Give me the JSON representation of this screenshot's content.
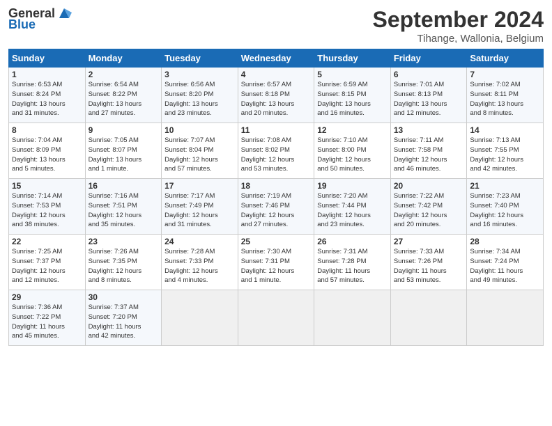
{
  "header": {
    "logo_text_general": "General",
    "logo_text_blue": "Blue",
    "month_title": "September 2024",
    "location": "Tihange, Wallonia, Belgium"
  },
  "weekdays": [
    "Sunday",
    "Monday",
    "Tuesday",
    "Wednesday",
    "Thursday",
    "Friday",
    "Saturday"
  ],
  "weeks": [
    [
      {
        "day": "1",
        "info": "Sunrise: 6:53 AM\nSunset: 8:24 PM\nDaylight: 13 hours\nand 31 minutes."
      },
      {
        "day": "2",
        "info": "Sunrise: 6:54 AM\nSunset: 8:22 PM\nDaylight: 13 hours\nand 27 minutes."
      },
      {
        "day": "3",
        "info": "Sunrise: 6:56 AM\nSunset: 8:20 PM\nDaylight: 13 hours\nand 23 minutes."
      },
      {
        "day": "4",
        "info": "Sunrise: 6:57 AM\nSunset: 8:18 PM\nDaylight: 13 hours\nand 20 minutes."
      },
      {
        "day": "5",
        "info": "Sunrise: 6:59 AM\nSunset: 8:15 PM\nDaylight: 13 hours\nand 16 minutes."
      },
      {
        "day": "6",
        "info": "Sunrise: 7:01 AM\nSunset: 8:13 PM\nDaylight: 13 hours\nand 12 minutes."
      },
      {
        "day": "7",
        "info": "Sunrise: 7:02 AM\nSunset: 8:11 PM\nDaylight: 13 hours\nand 8 minutes."
      }
    ],
    [
      {
        "day": "8",
        "info": "Sunrise: 7:04 AM\nSunset: 8:09 PM\nDaylight: 13 hours\nand 5 minutes."
      },
      {
        "day": "9",
        "info": "Sunrise: 7:05 AM\nSunset: 8:07 PM\nDaylight: 13 hours\nand 1 minute."
      },
      {
        "day": "10",
        "info": "Sunrise: 7:07 AM\nSunset: 8:04 PM\nDaylight: 12 hours\nand 57 minutes."
      },
      {
        "day": "11",
        "info": "Sunrise: 7:08 AM\nSunset: 8:02 PM\nDaylight: 12 hours\nand 53 minutes."
      },
      {
        "day": "12",
        "info": "Sunrise: 7:10 AM\nSunset: 8:00 PM\nDaylight: 12 hours\nand 50 minutes."
      },
      {
        "day": "13",
        "info": "Sunrise: 7:11 AM\nSunset: 7:58 PM\nDaylight: 12 hours\nand 46 minutes."
      },
      {
        "day": "14",
        "info": "Sunrise: 7:13 AM\nSunset: 7:55 PM\nDaylight: 12 hours\nand 42 minutes."
      }
    ],
    [
      {
        "day": "15",
        "info": "Sunrise: 7:14 AM\nSunset: 7:53 PM\nDaylight: 12 hours\nand 38 minutes."
      },
      {
        "day": "16",
        "info": "Sunrise: 7:16 AM\nSunset: 7:51 PM\nDaylight: 12 hours\nand 35 minutes."
      },
      {
        "day": "17",
        "info": "Sunrise: 7:17 AM\nSunset: 7:49 PM\nDaylight: 12 hours\nand 31 minutes."
      },
      {
        "day": "18",
        "info": "Sunrise: 7:19 AM\nSunset: 7:46 PM\nDaylight: 12 hours\nand 27 minutes."
      },
      {
        "day": "19",
        "info": "Sunrise: 7:20 AM\nSunset: 7:44 PM\nDaylight: 12 hours\nand 23 minutes."
      },
      {
        "day": "20",
        "info": "Sunrise: 7:22 AM\nSunset: 7:42 PM\nDaylight: 12 hours\nand 20 minutes."
      },
      {
        "day": "21",
        "info": "Sunrise: 7:23 AM\nSunset: 7:40 PM\nDaylight: 12 hours\nand 16 minutes."
      }
    ],
    [
      {
        "day": "22",
        "info": "Sunrise: 7:25 AM\nSunset: 7:37 PM\nDaylight: 12 hours\nand 12 minutes."
      },
      {
        "day": "23",
        "info": "Sunrise: 7:26 AM\nSunset: 7:35 PM\nDaylight: 12 hours\nand 8 minutes."
      },
      {
        "day": "24",
        "info": "Sunrise: 7:28 AM\nSunset: 7:33 PM\nDaylight: 12 hours\nand 4 minutes."
      },
      {
        "day": "25",
        "info": "Sunrise: 7:30 AM\nSunset: 7:31 PM\nDaylight: 12 hours\nand 1 minute."
      },
      {
        "day": "26",
        "info": "Sunrise: 7:31 AM\nSunset: 7:28 PM\nDaylight: 11 hours\nand 57 minutes."
      },
      {
        "day": "27",
        "info": "Sunrise: 7:33 AM\nSunset: 7:26 PM\nDaylight: 11 hours\nand 53 minutes."
      },
      {
        "day": "28",
        "info": "Sunrise: 7:34 AM\nSunset: 7:24 PM\nDaylight: 11 hours\nand 49 minutes."
      }
    ],
    [
      {
        "day": "29",
        "info": "Sunrise: 7:36 AM\nSunset: 7:22 PM\nDaylight: 11 hours\nand 45 minutes."
      },
      {
        "day": "30",
        "info": "Sunrise: 7:37 AM\nSunset: 7:20 PM\nDaylight: 11 hours\nand 42 minutes."
      },
      {
        "day": "",
        "info": ""
      },
      {
        "day": "",
        "info": ""
      },
      {
        "day": "",
        "info": ""
      },
      {
        "day": "",
        "info": ""
      },
      {
        "day": "",
        "info": ""
      }
    ]
  ]
}
